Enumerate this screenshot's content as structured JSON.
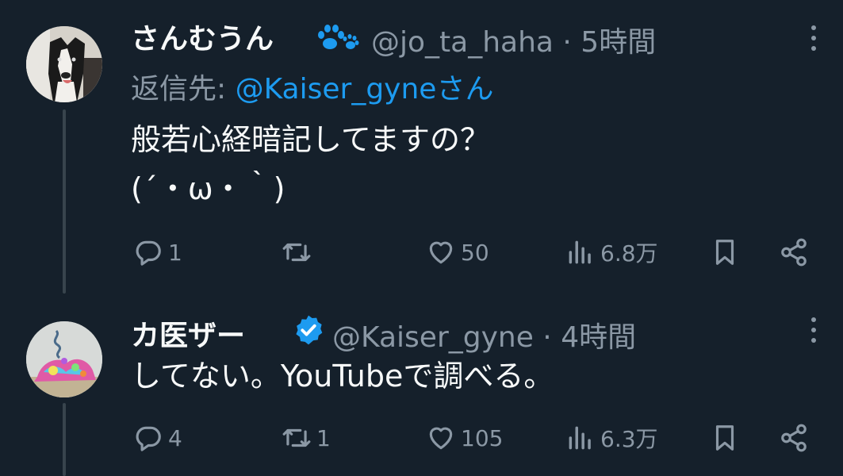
{
  "tweets": [
    {
      "name": "さんむうん",
      "name_icon": "paw-icon",
      "handle": "@jo_ta_haha · 5時間",
      "reply_prefix": "返信先: ",
      "reply_mention": "@Kaiser_gyne",
      "reply_suffix": "さん",
      "text": "般若心経暗記してますの？\n(´・ω・｀)",
      "replies": "1",
      "retweets": "",
      "likes": "50",
      "views": "6.8万"
    },
    {
      "name": "カ医ザー",
      "name_icon": "verified-icon",
      "handle": "@Kaiser_gyne · 4時間",
      "text": "してない。YouTubeで調べる。",
      "replies": "4",
      "retweets": "1",
      "likes": "105",
      "views": "6.3万"
    }
  ],
  "colors": {
    "background": "#15202b",
    "text": "#f7f9f9",
    "secondary": "#8b98a5",
    "accent": "#1d9bf0"
  }
}
